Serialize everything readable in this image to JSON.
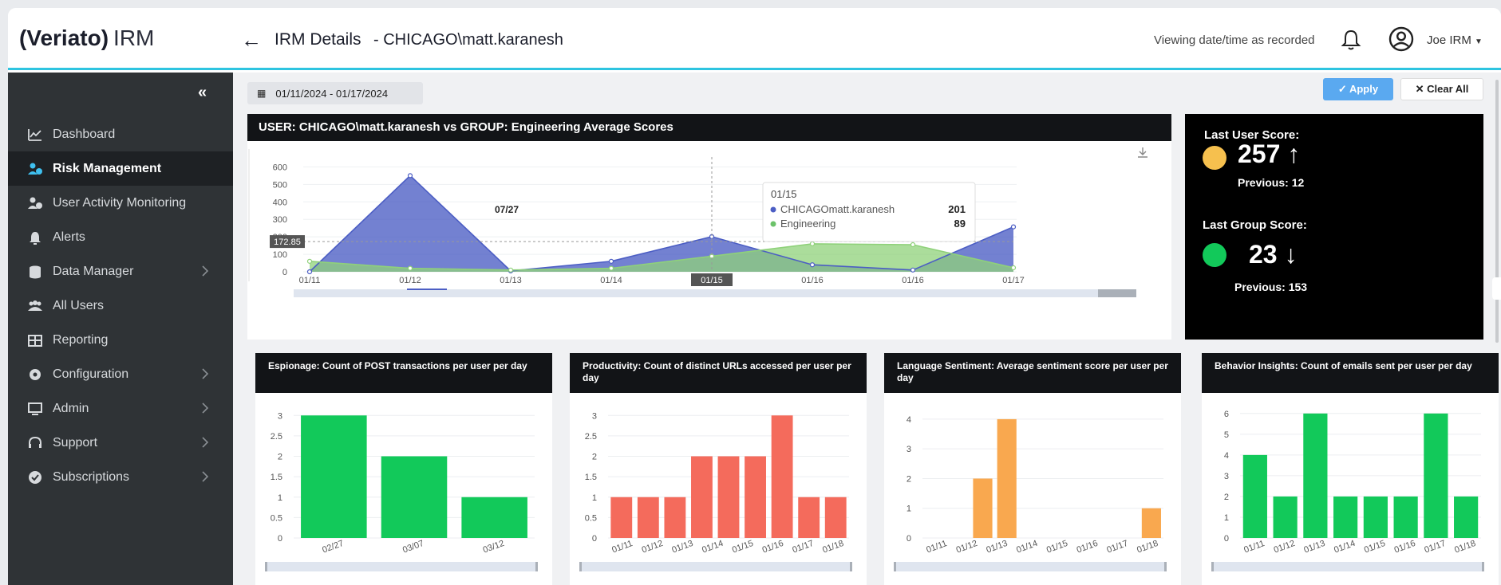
{
  "logo": {
    "brand": "Veriato",
    "suffix": "IRM"
  },
  "header": {
    "title": "IRM Details",
    "subtitle": "- CHICAGO\\matt.karanesh",
    "viewing": "Viewing date/time as recorded",
    "user": "Joe IRM"
  },
  "sidebar": {
    "items": [
      {
        "label": "Dashboard",
        "icon": "chart-icon"
      },
      {
        "label": "Risk Management",
        "icon": "user-risk-icon",
        "active": true
      },
      {
        "label": "User Activity Monitoring",
        "icon": "user-monitor-icon"
      },
      {
        "label": "Alerts",
        "icon": "bell-icon"
      },
      {
        "label": "Data Manager",
        "icon": "database-icon",
        "chevron": true
      },
      {
        "label": "All Users",
        "icon": "users-icon"
      },
      {
        "label": "Reporting",
        "icon": "table-icon"
      },
      {
        "label": "Configuration",
        "icon": "gear-icon",
        "chevron": true
      },
      {
        "label": "Admin",
        "icon": "monitor-icon",
        "chevron": true
      },
      {
        "label": "Support",
        "icon": "headset-icon",
        "chevron": true
      },
      {
        "label": "Subscriptions",
        "icon": "check-circle-icon",
        "chevron": true
      }
    ]
  },
  "filters": {
    "date_range": "01/11/2024 - 01/17/2024",
    "apply": "✓  Apply",
    "clear": "✕  Clear All"
  },
  "main_chart": {
    "title": "USER: CHICAGO\\matt.karanesh vs GROUP: Engineering Average Scores",
    "crosshair_value": "172.85",
    "peak_label": "07/27",
    "active_x": "01/15",
    "tooltip": {
      "date": "01/15",
      "rows": [
        {
          "name": "CHICAGOmatt.karanesh",
          "value": "201",
          "color": "#4c5ec4"
        },
        {
          "name": "Engineering",
          "value": "89",
          "color": "#6cc26a"
        }
      ]
    }
  },
  "score": {
    "user_label": "Last User Score:",
    "user_value": "257",
    "user_arrow": "↑",
    "user_prev": "Previous: 12",
    "user_color": "#f6c04e",
    "group_label": "Last Group Score:",
    "group_value": "23",
    "group_arrow": "↓",
    "group_prev": "Previous: 153",
    "group_color": "#12c95a"
  },
  "chart_data": [
    {
      "type": "area",
      "title": "USER: CHICAGO\\matt.karanesh vs GROUP: Engineering Average Scores",
      "x": [
        "01/11",
        "01/12",
        "01/13",
        "01/14",
        "01/15",
        "01/16",
        "01/16",
        "01/17"
      ],
      "series": [
        {
          "name": "CHICAGOmatt.karanesh",
          "values": [
            0,
            550,
            5,
            60,
            201,
            40,
            10,
            257
          ],
          "color": "#4c5ec4"
        },
        {
          "name": "Engineering",
          "values": [
            60,
            20,
            10,
            20,
            89,
            160,
            155,
            23
          ],
          "color": "#8fd17a"
        }
      ],
      "yticks": [
        0,
        100,
        200,
        300,
        400,
        500,
        600
      ],
      "ylim": [
        0,
        620
      ]
    },
    {
      "type": "bar",
      "title": "Espionage: Count of POST transactions per user per day",
      "categories": [
        "02/27",
        "03/07",
        "03/12"
      ],
      "values": [
        3,
        2,
        1
      ],
      "yticks": [
        "0",
        "0.5",
        "1",
        "1.5",
        "2",
        "2.5",
        "3"
      ],
      "ylim": [
        0,
        3.2
      ],
      "color": "#12c95a"
    },
    {
      "type": "bar",
      "title": "Productivity: Count of distinct URLs accessed per user per day",
      "categories": [
        "01/11",
        "01/12",
        "01/13",
        "01/14",
        "01/15",
        "01/16",
        "01/17",
        "01/18"
      ],
      "values": [
        1,
        1,
        1,
        2,
        2,
        2,
        3,
        1,
        1
      ],
      "yticks": [
        "0",
        "0.5",
        "1",
        "1.5",
        "2",
        "2.5",
        "3"
      ],
      "ylim": [
        0,
        3.2
      ],
      "color": "#f46b5c"
    },
    {
      "type": "bar",
      "title": "Language Sentiment: Average sentiment score per user per day",
      "categories": [
        "01/11",
        "01/12",
        "01/13",
        "01/14",
        "01/15",
        "01/16",
        "01/17",
        "01/18"
      ],
      "values": [
        0,
        0,
        2,
        4,
        0,
        0,
        0,
        0,
        0,
        1
      ],
      "yticks": [
        "0",
        "1",
        "2",
        "3",
        "4"
      ],
      "ylim": [
        0,
        4.4
      ],
      "color": "#f9a84f"
    },
    {
      "type": "bar",
      "title": "Behavior Insights: Count of emails sent per user per day",
      "categories": [
        "01/11",
        "01/12",
        "01/13",
        "01/14",
        "01/15",
        "01/16",
        "01/17",
        "01/18"
      ],
      "values": [
        4,
        2,
        6,
        2,
        2,
        2,
        6,
        2
      ],
      "yticks": [
        "0",
        "1",
        "2",
        "3",
        "4",
        "5",
        "6"
      ],
      "ylim": [
        0,
        6.3
      ],
      "color": "#12c95a"
    }
  ]
}
